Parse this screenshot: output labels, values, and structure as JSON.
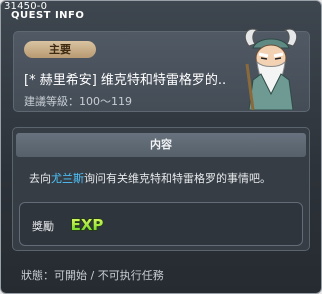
{
  "window": {
    "quest_id": "31450-0",
    "title": "QUEST INFO"
  },
  "quest": {
    "category_tag": "主要",
    "name": "[* 赫里希安] 维克特和特雷格罗的..",
    "level_requirement": "建議等級：100～119"
  },
  "content": {
    "header": "内容",
    "text_before": "去向",
    "text_highlight": "尤兰斯",
    "text_after": "询问有关维克特和特雷格罗的事情吧。",
    "highlight_color": "#4fc6ff"
  },
  "reward": {
    "label": "獎勵",
    "icon": "exp-icon",
    "icon_text": "EXP"
  },
  "status": {
    "text": "狀態：可開始 / 不可执行任務"
  }
}
